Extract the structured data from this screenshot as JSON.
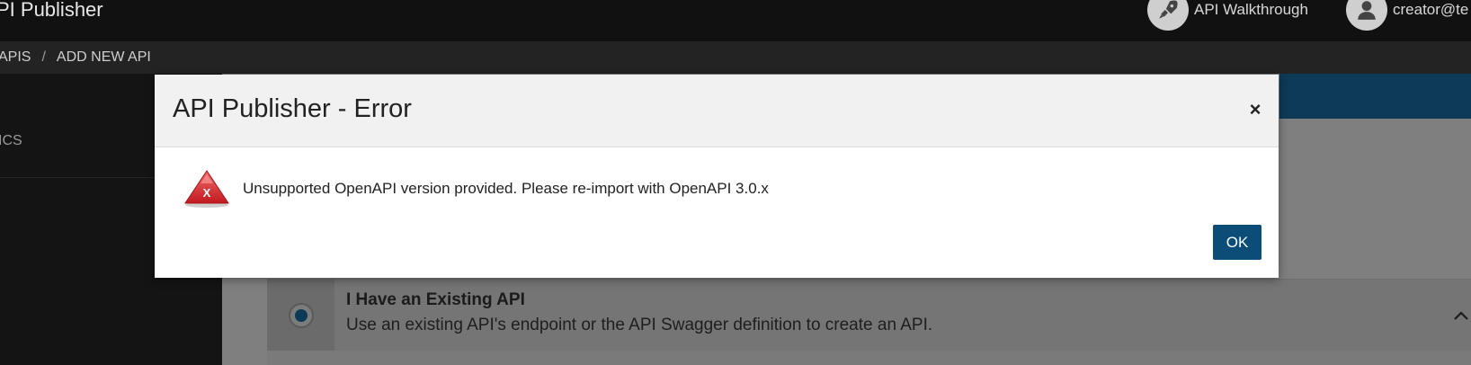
{
  "header": {
    "app_title": "PI Publisher",
    "walkthrough_label": "API Walkthrough",
    "user_label": "creator@te",
    "walkthrough_icon": "rocket-icon",
    "user_icon": "user-icon"
  },
  "breadcrumb": {
    "items": [
      "APIS",
      "ADD NEW API"
    ],
    "separator": "/"
  },
  "sidebar": {
    "items": [
      {
        "label": "ICS"
      }
    ]
  },
  "main": {
    "option": {
      "title": "I Have an Existing API",
      "description": "Use an existing API's endpoint or the API Swagger definition to create an API."
    }
  },
  "modal": {
    "title": "API Publisher - Error",
    "close_label": "×",
    "message": "Unsupported OpenAPI version provided. Please re-import with OpenAPI 3.0.x",
    "ok_label": "OK",
    "error_icon_glyph": "X"
  },
  "colors": {
    "accent": "#0c4d78",
    "header_bg": "#111111",
    "error_red": "#d9292e"
  }
}
